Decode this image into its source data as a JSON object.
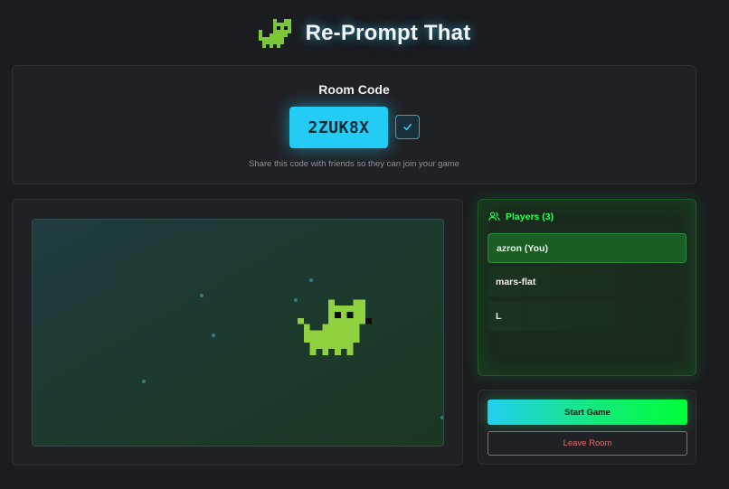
{
  "app": {
    "title": "Re-Prompt That"
  },
  "room": {
    "label": "Room Code",
    "code": "2ZUK8X",
    "copy_state": "check-icon",
    "share_text": "Share this code with friends so they can join your game"
  },
  "canvas": {
    "sprite": "pixel-cat"
  },
  "players": {
    "heading": "Players (3)",
    "list": [
      {
        "name": "azron (You)",
        "is_you": true
      },
      {
        "name": "mars-flat",
        "is_you": false
      },
      {
        "name": "L",
        "is_you": false
      }
    ]
  },
  "actions": {
    "start_label": "Start Game",
    "leave_label": "Leave Room"
  },
  "colors": {
    "accent_cyan": "#22ccf4",
    "accent_green": "#00ff37",
    "danger": "#e36b6b",
    "background": "#1b1c1f"
  }
}
